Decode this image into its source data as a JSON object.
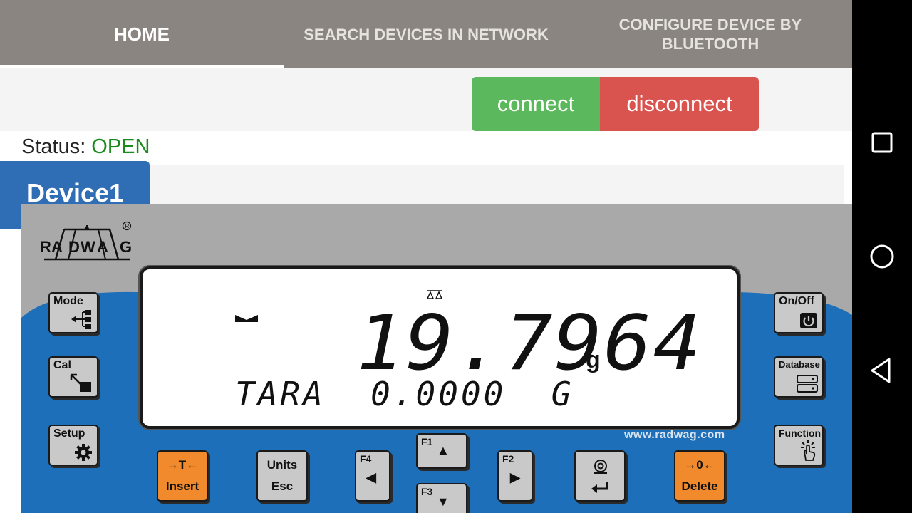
{
  "tabs": [
    {
      "label": "HOME"
    },
    {
      "label": "SEARCH DEVICES IN NETWORK"
    },
    {
      "label": "CONFIGURE DEVICE BY BLUETOOTH"
    }
  ],
  "actions": {
    "connect_label": "connect",
    "disconnect_label": "disconnect"
  },
  "status": {
    "label": "Status:",
    "value": "OPEN"
  },
  "device": {
    "tab_label": "Device1"
  },
  "scale": {
    "brand_logo_text": "RADWAG",
    "reading": "19.7964",
    "unit": "g",
    "tare_line": "TARA  0.0000  G",
    "website": "www.radwag.com",
    "keys": {
      "mode": "Mode",
      "cal": "Cal",
      "setup": "Setup",
      "onoff": "On/Off",
      "database": "Database",
      "function": "Function",
      "tare_symbol": "→T←",
      "insert": "Insert",
      "units": "Units",
      "esc": "Esc",
      "f1": "F1",
      "f2": "F2",
      "f3": "F3",
      "f4": "F4",
      "zero_symbol": "→0←",
      "delete": "Delete"
    },
    "colors": {
      "panel_blue": "#1c6fb8",
      "panel_gray": "#a9a9a9",
      "key_orange": "#f08a2c"
    }
  },
  "navbar": {
    "icons": [
      "recents-square-icon",
      "home-circle-icon",
      "back-triangle-icon"
    ]
  },
  "colors": {
    "connect": "#5cb85c",
    "disconnect": "#d9534f",
    "tabbar": "#8a8580",
    "device_tab": "#2f6db5",
    "status_ok": "#1a8a1a"
  }
}
